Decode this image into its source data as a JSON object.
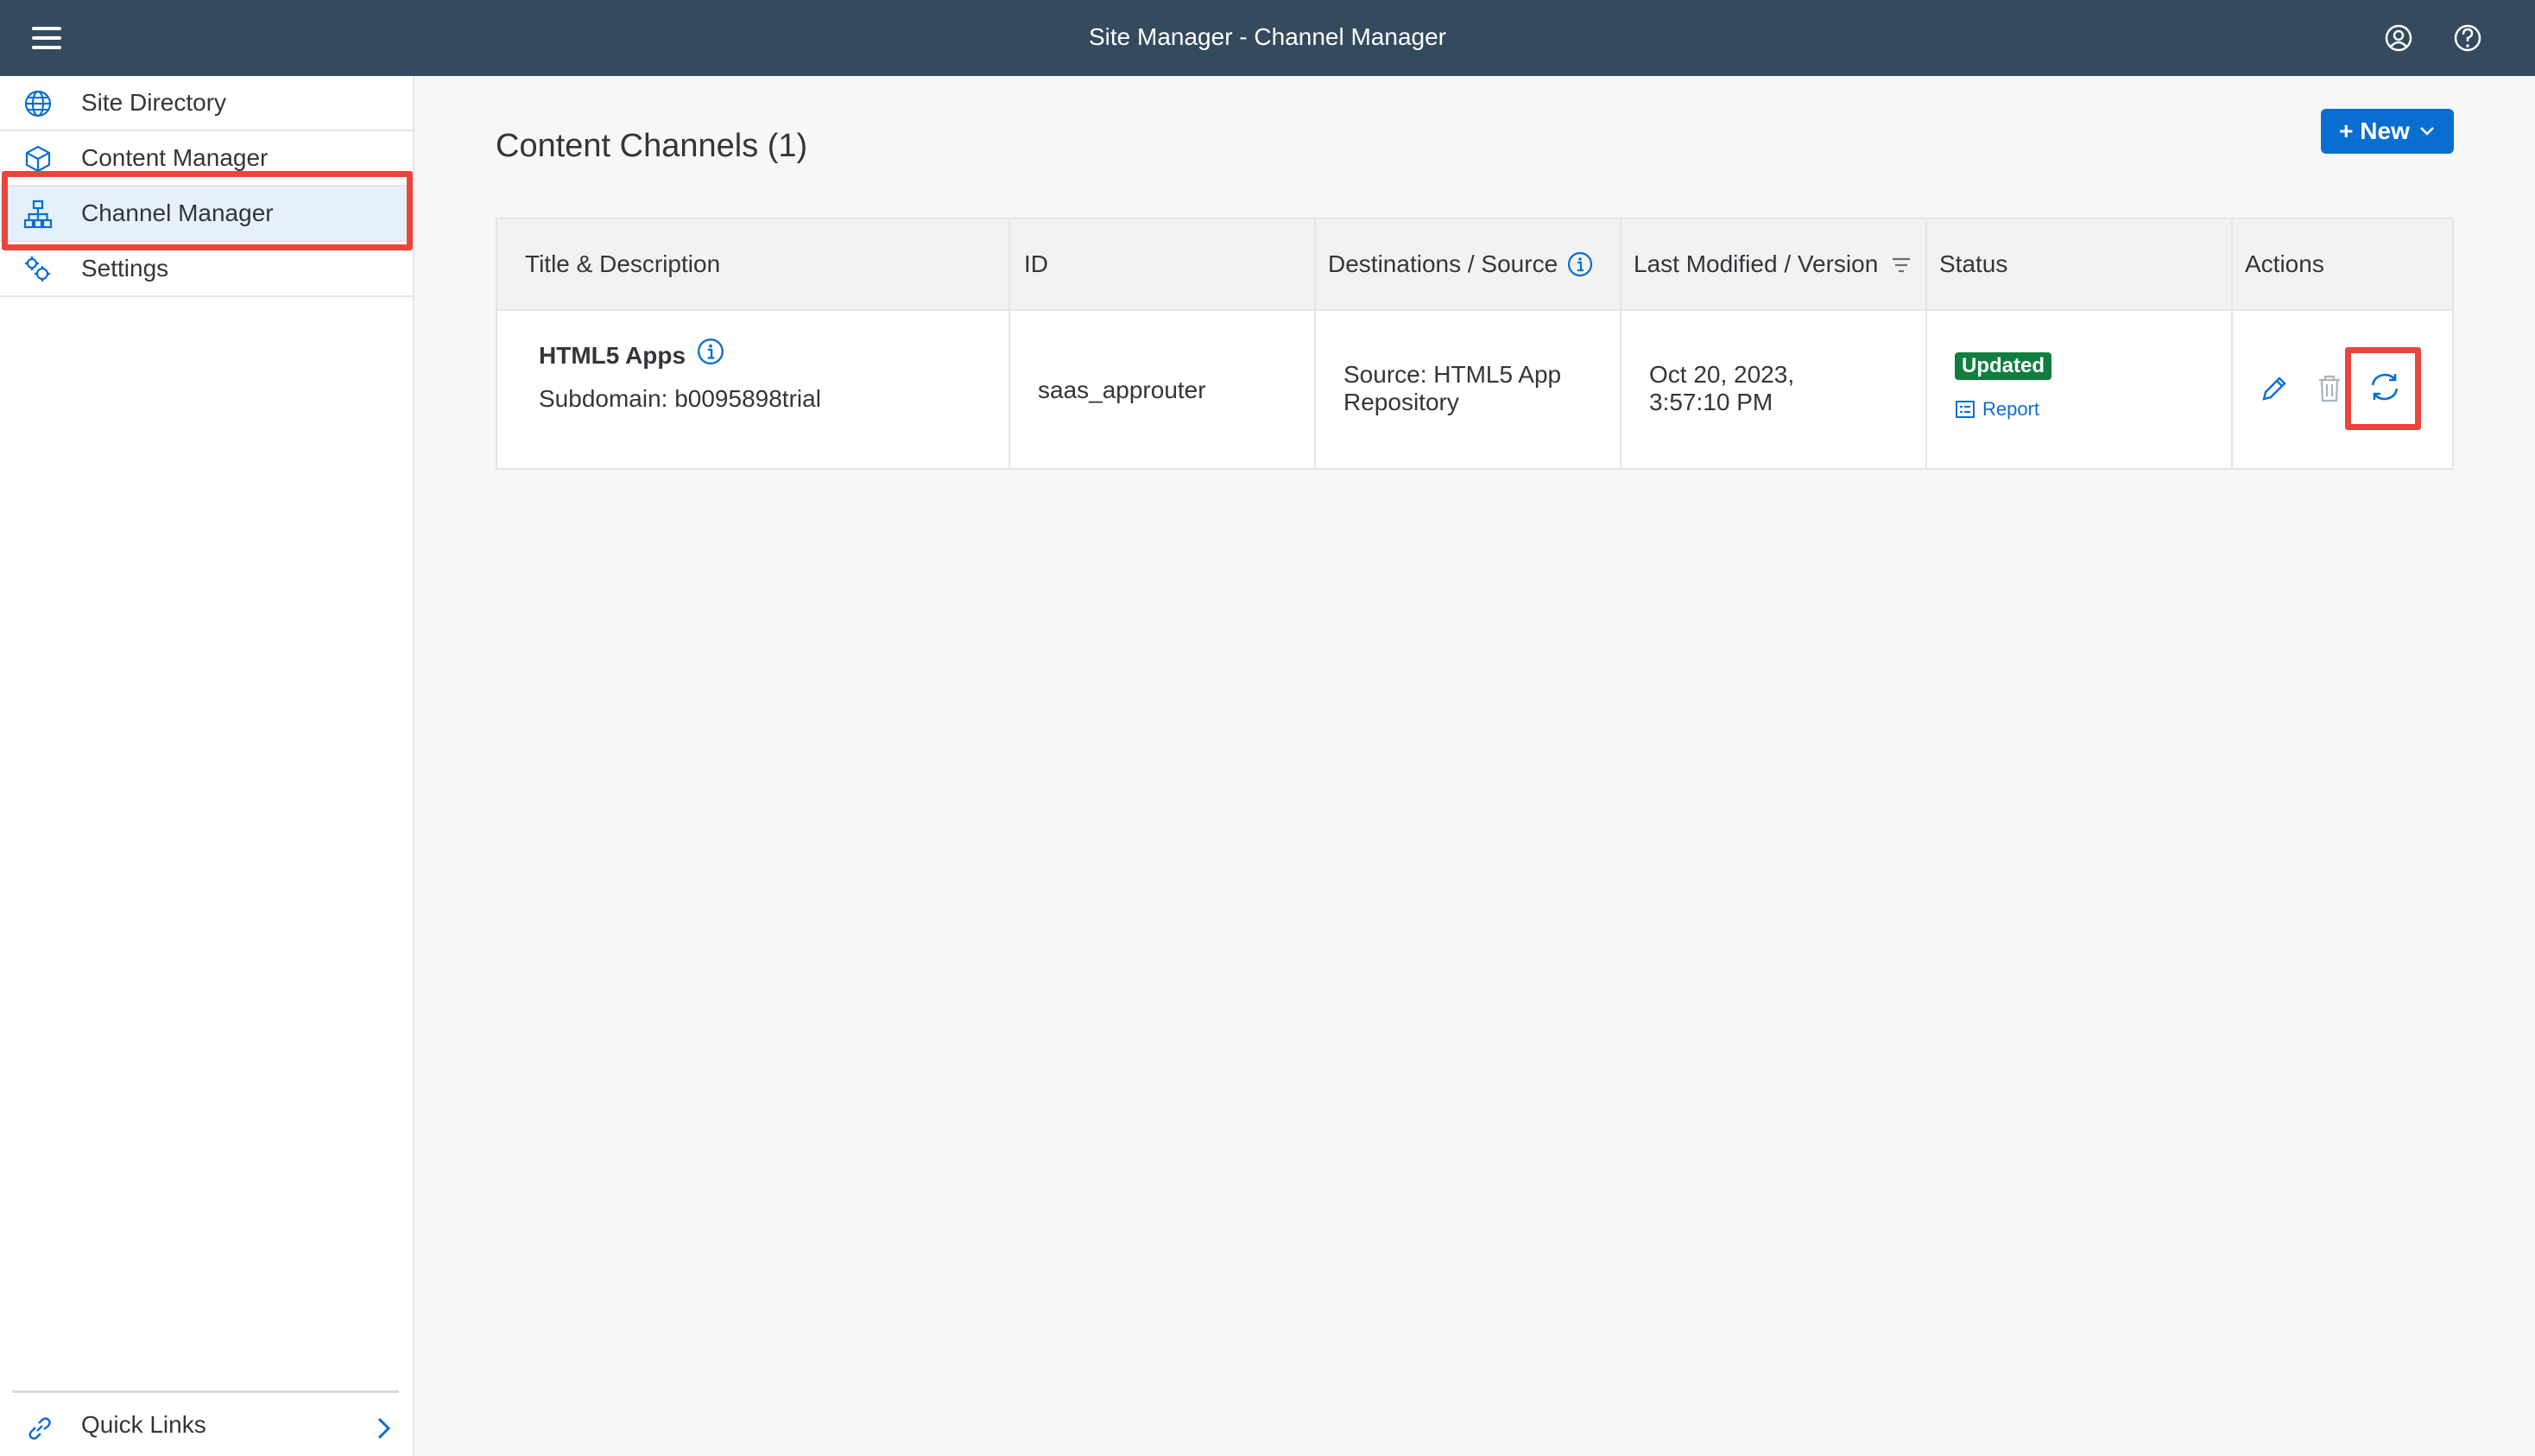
{
  "header": {
    "title": "Site Manager - Channel Manager",
    "menu_icon": "hamburger-icon",
    "user_icon": "user-icon",
    "help_icon": "help-icon"
  },
  "sidebar": {
    "items": [
      {
        "label": "Site Directory",
        "icon": "globe-icon"
      },
      {
        "label": "Content Manager",
        "icon": "cube-icon"
      },
      {
        "label": "Channel Manager",
        "icon": "org-chart-icon",
        "selected": true
      },
      {
        "label": "Settings",
        "icon": "gears-icon"
      }
    ],
    "quick_links": {
      "label": "Quick Links",
      "icon": "link-icon"
    }
  },
  "main": {
    "title": "Content Channels (1)",
    "new_button": {
      "label": "+ New"
    }
  },
  "table": {
    "columns": [
      "Title & Description",
      "ID",
      "Destinations / Source",
      "Last Modified / Version",
      "Status",
      "Actions"
    ],
    "rows": [
      {
        "title": "HTML5 Apps",
        "description": "Subdomain: b0095898trial",
        "id": "saas_approuter",
        "source_line1": "Source: HTML5 App",
        "source_line2": "Repository",
        "modified_line1": "Oct 20, 2023,",
        "modified_line2": "3:57:10 PM",
        "status": "Updated",
        "report_label": "Report"
      }
    ]
  },
  "colors": {
    "shell": "#354a5f",
    "accent": "#0a6ed1",
    "success": "#107e3e",
    "highlight": "#e8453c",
    "selected_bg": "#e5f0fa"
  }
}
